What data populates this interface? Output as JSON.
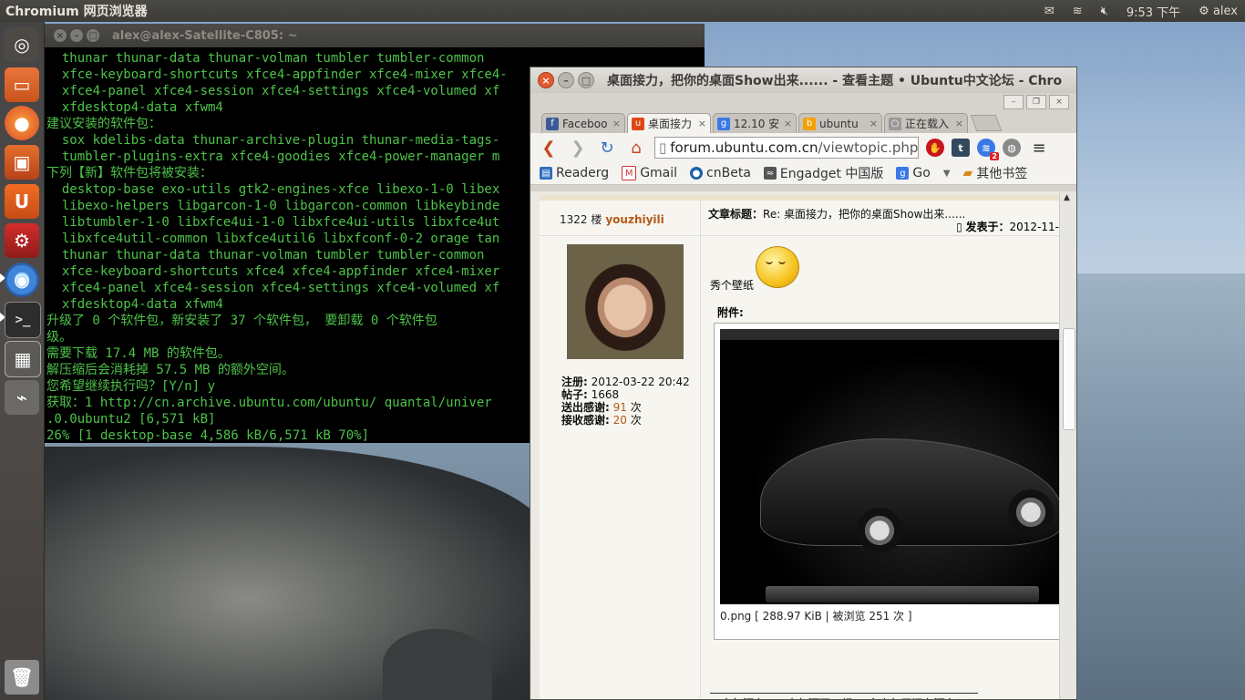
{
  "top_panel": {
    "app_title": "Chromium 网页浏览器",
    "clock": "9:53 下午",
    "user": "alex"
  },
  "launcher": {
    "items": [
      "dash-home",
      "files",
      "firefox",
      "software-center",
      "ubuntu-one",
      "system-settings",
      "chromium",
      "terminal",
      "workspace-switcher",
      "usb-drive",
      "trash"
    ]
  },
  "terminal": {
    "title": "alex@alex-Satellite-C805: ~",
    "lines": [
      "  thunar thunar-data thunar-volman tumbler tumbler-common",
      "  xfce-keyboard-shortcuts xfce4-appfinder xfce4-mixer xfce4-",
      "  xfce4-panel xfce4-session xfce4-settings xfce4-volumed xf",
      "  xfdesktop4-data xfwm4",
      "建议安装的软件包：",
      "  sox kdelibs-data thunar-archive-plugin thunar-media-tags-",
      "  tumbler-plugins-extra xfce4-goodies xfce4-power-manager m",
      "下列【新】软件包将被安装：",
      "  desktop-base exo-utils gtk2-engines-xfce libexo-1-0 libex",
      "  libexo-helpers libgarcon-1-0 libgarcon-common libkeybinde",
      "  libtumbler-1-0 libxfce4ui-1-0 libxfce4ui-utils libxfce4ut",
      "  libxfce4util-common libxfce4util6 libxfconf-0-2 orage tan",
      "  thunar thunar-data thunar-volman tumbler tumbler-common",
      "  xfce-keyboard-shortcuts xfce4 xfce4-appfinder xfce4-mixer",
      "  xfce4-panel xfce4-session xfce4-settings xfce4-volumed xf",
      "  xfdesktop4-data xfwm4",
      "升级了 0 个软件包，新安装了 37 个软件包， 要卸载 0 个软件包",
      "级。",
      "需要下载 17.4 MB 的软件包。",
      "解压缩后会消耗掉 57.5 MB 的额外空间。",
      "您希望继续执行吗？[Y/n] y",
      "获取：1 http://cn.archive.ubuntu.com/ubuntu/ quantal/univer",
      ".0.0ubuntu2 [6,571 kB]",
      "26% [1 desktop-base 4,586 kB/6,571 kB 70%]"
    ]
  },
  "chrome": {
    "title": "桌面接力，把你的桌面Show出来...... - 查看主题 • Ubuntu中文论坛 - Chro",
    "tabs": [
      {
        "label": "Faceboo",
        "icon": "f",
        "color": "#3b5998"
      },
      {
        "label": "桌面接力",
        "icon": "u",
        "color": "#dd4814"
      },
      {
        "label": "12.10 安",
        "icon": "g",
        "color": "#3b78e7"
      },
      {
        "label": "ubuntu",
        "icon": "b",
        "color": "#f2a100"
      },
      {
        "label": "正在载入",
        "icon": "○",
        "color": "#999999"
      }
    ],
    "url_host": "forum.ubuntu.com.cn",
    "url_path": "/viewtopic.php",
    "bookmarks": [
      "Readerg",
      "Gmail",
      "cnBeta",
      "Engadget 中国版",
      "Go"
    ],
    "other_bookmarks": "其他书签",
    "ext_badge": "2"
  },
  "post": {
    "floor": "1322 楼",
    "username": "youzhiyili",
    "subject_label": "文章标题：",
    "subject": "Re: 桌面接力，把你的桌面Show出来......",
    "posted_label": "发表于：",
    "posted_date": "2012-11-",
    "stats": {
      "register_label": "注册:",
      "register": "2012-03-22 20:42",
      "posts_label": "帖子:",
      "posts": "1668",
      "thanks_out_label": "送出感谢:",
      "thanks_out": "91",
      "thanks_in_label": "接收感谢:",
      "thanks_in": "20",
      "unit": "次"
    },
    "text": "秀个壁纸",
    "attachment_label": "附件:",
    "attachment_caption": "0.png [ 288.97 KiB | 被浏览 251 次 ]",
    "signature": "三十年河东，三十年河西，都TM多少年了还在河东！！"
  }
}
